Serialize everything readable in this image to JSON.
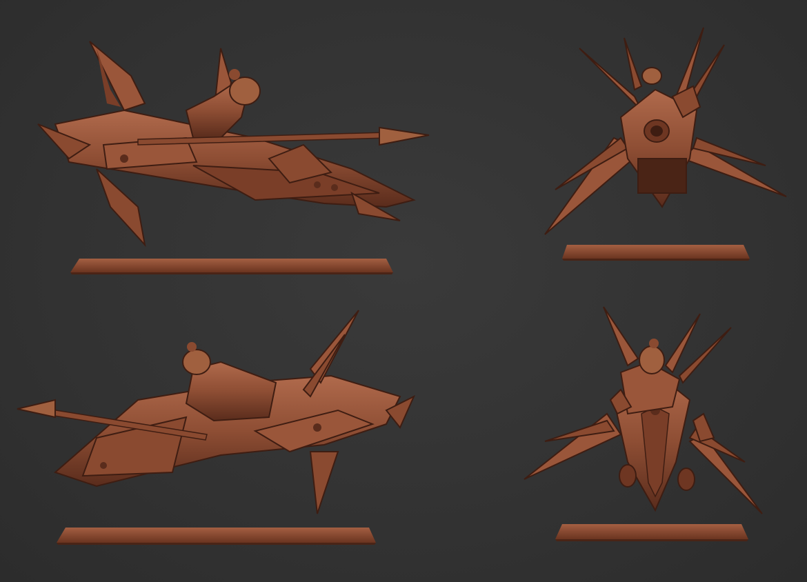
{
  "scene": {
    "subject": "sculpted-miniature-jetbike-with-rider",
    "colors": {
      "background": "#343434",
      "clay_base": "#8e4e34",
      "clay_light": "#b06a4c",
      "clay_dark": "#5a2c1c",
      "clay_shadow": "#3e1d12"
    },
    "views": [
      {
        "id": "side-left",
        "orientation": "side"
      },
      {
        "id": "front",
        "orientation": "front"
      },
      {
        "id": "side-right",
        "orientation": "side-mirrored"
      },
      {
        "id": "three-quarter",
        "orientation": "three-quarter"
      }
    ]
  }
}
